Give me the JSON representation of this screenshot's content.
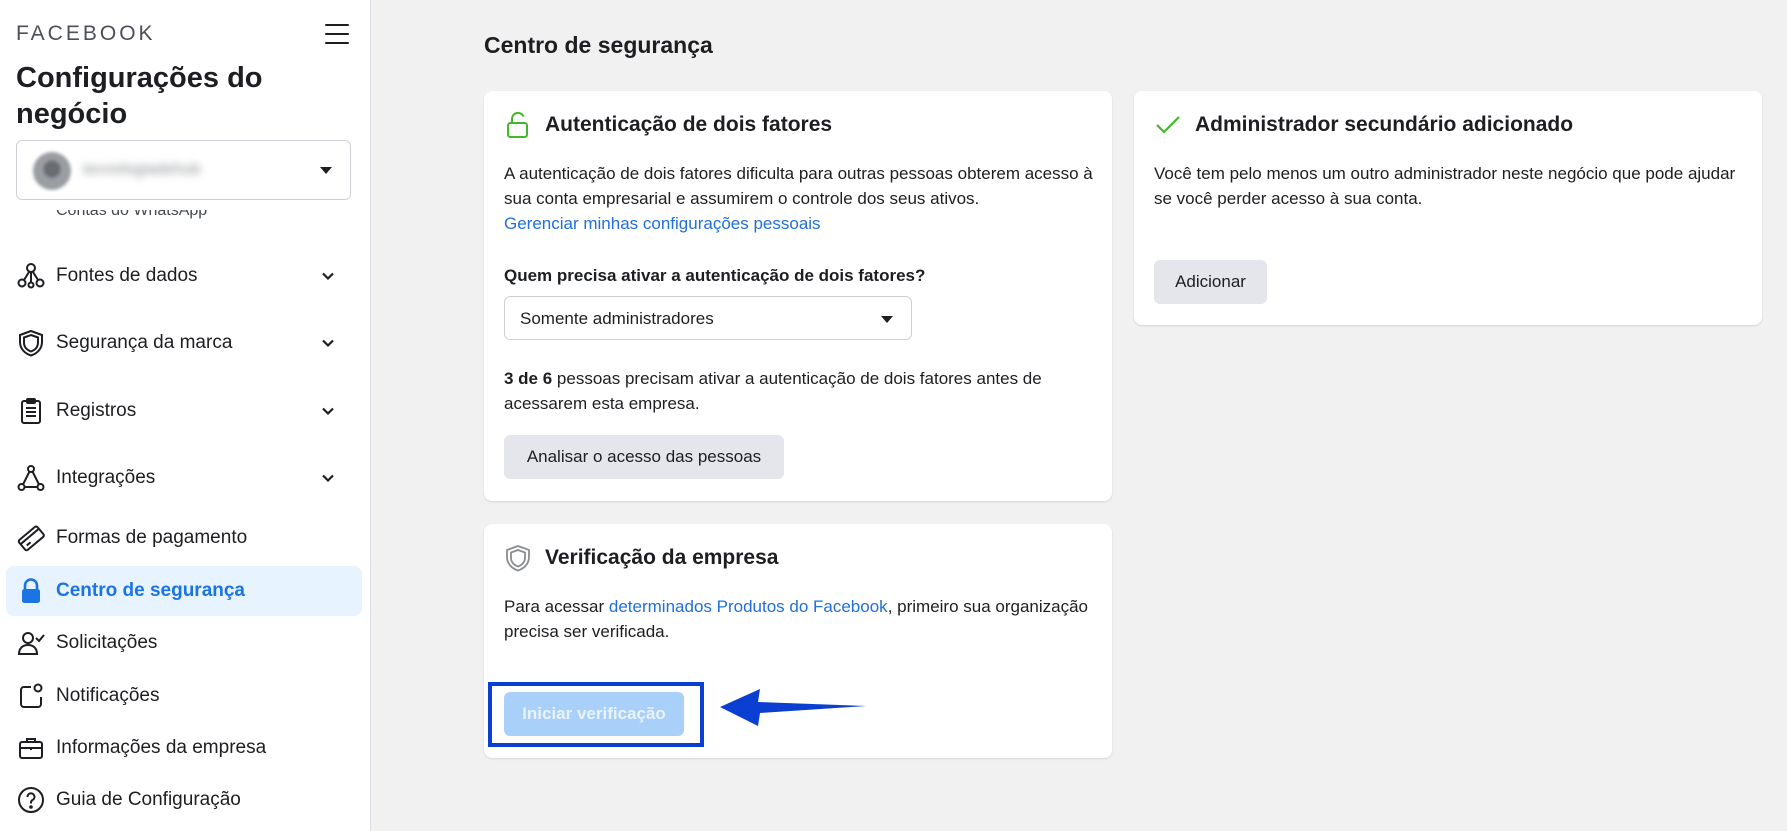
{
  "sidebar": {
    "brand": "FACEBOOK",
    "title": "Configurações do negócio",
    "account": {
      "name": "tecnologiadehub"
    },
    "partial_item_label": "Contas do WhatsApp",
    "items": [
      {
        "label": "Fontes de dados",
        "icon": "data-sources-icon",
        "has_chevron": true
      },
      {
        "label": "Segurança da marca",
        "icon": "shield-icon",
        "has_chevron": true
      },
      {
        "label": "Registros",
        "icon": "clipboard-icon",
        "has_chevron": true
      },
      {
        "label": "Integrações",
        "icon": "integrations-icon",
        "has_chevron": true
      },
      {
        "label": "Formas de pagamento",
        "icon": "credit-card-icon",
        "has_chevron": false
      },
      {
        "label": "Centro de segurança",
        "icon": "lock-icon",
        "has_chevron": false,
        "active": true
      },
      {
        "label": "Solicitações",
        "icon": "person-check-icon",
        "has_chevron": false
      },
      {
        "label": "Notificações",
        "icon": "notification-icon",
        "has_chevron": false
      },
      {
        "label": "Informações da empresa",
        "icon": "briefcase-icon",
        "has_chevron": false
      },
      {
        "label": "Guia de Configuração",
        "icon": "question-icon",
        "has_chevron": false
      }
    ]
  },
  "main": {
    "title": "Centro de segurança",
    "two_factor": {
      "title": "Autenticação de dois fatores",
      "icon": "unlock-icon",
      "description": "A autenticação de dois fatores dificulta para outras pessoas obterem acesso à sua conta empresarial e assumirem o controle dos seus ativos.",
      "link": "Gerenciar minhas configurações pessoais",
      "question": "Quem precisa ativar a autenticação de dois fatores?",
      "dropdown_value": "Somente administradores",
      "count": "3 de 6",
      "count_text": " pessoas precisam ativar a autenticação de dois fatores antes de acessarem esta empresa.",
      "button": "Analisar o acesso das pessoas"
    },
    "secondary_admin": {
      "title": "Administrador secundário adicionado",
      "icon": "checkmark-icon",
      "description": "Você tem pelo menos um outro administrador neste negócio que pode ajudar se você perder acesso à sua conta.",
      "button": "Adicionar"
    },
    "verification": {
      "title": "Verificação da empresa",
      "icon": "shield-icon",
      "text_before": "Para acessar ",
      "link": "determinados Produtos do Facebook",
      "text_after": ", primeiro sua organização precisa ser verificada.",
      "button": "Iniciar verificação"
    }
  },
  "colors": {
    "accent": "#1b74e4",
    "active_bg": "#e7f3ff",
    "success_green": "#42b72a",
    "annotation_blue": "#0a3fd1",
    "disabled_button": "#a9d0f9"
  }
}
